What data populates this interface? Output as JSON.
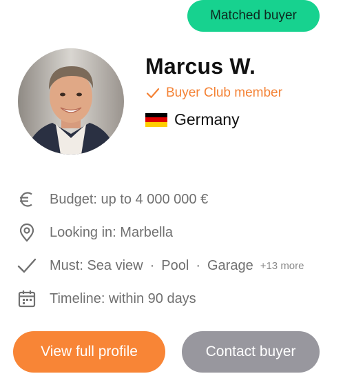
{
  "badge": {
    "label": "Matched buyer",
    "color": "#17d28f"
  },
  "profile": {
    "name": "Marcus W.",
    "club_label": "Buyer Club member",
    "country": "Germany",
    "avatar_icon": "profile-photo"
  },
  "facts": {
    "budget": {
      "icon": "euro-icon",
      "text": "Budget: up to 4 000 000 €"
    },
    "location": {
      "icon": "location-pin-icon",
      "text": "Looking in: Marbella"
    },
    "must": {
      "icon": "check-icon",
      "prefix": "Must: ",
      "items": [
        "Sea view",
        "Pool",
        "Garage"
      ],
      "separator": "·",
      "more": "+13 more"
    },
    "timeline": {
      "icon": "calendar-icon",
      "text": "Timeline: within 90 days"
    }
  },
  "actions": {
    "primary": {
      "label": "View full profile",
      "color": "#f88536"
    },
    "secondary": {
      "label": "Contact buyer",
      "color": "#98979e"
    }
  },
  "colors": {
    "accent": "#f48235",
    "muted_text": "#707070"
  }
}
